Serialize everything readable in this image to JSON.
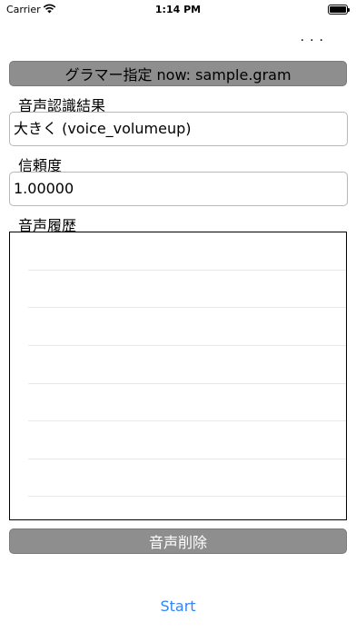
{
  "status_bar": {
    "carrier": "Carrier",
    "time": "1:14 PM",
    "battery_level": 1.0
  },
  "menu": {
    "more_label": "..."
  },
  "grammar_button": {
    "label": "グラマー指定 now: sample.gram"
  },
  "recognition": {
    "result_label": "音声認識結果",
    "result_value": "大きく (voice_volumeup)",
    "confidence_label": "信頼度",
    "confidence_value": "1.00000"
  },
  "history": {
    "label": "音声履歴",
    "rows": []
  },
  "delete_button": {
    "label": "音声削除"
  },
  "start_button": {
    "label": "Start"
  },
  "colors": {
    "button_gray": "#8e8e8e",
    "link_blue": "#2f86f6"
  }
}
